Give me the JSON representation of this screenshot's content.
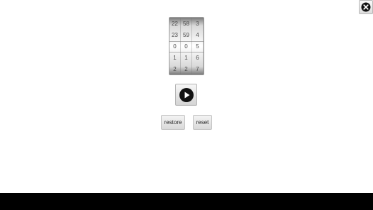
{
  "picker": {
    "columns": [
      [
        "22",
        "23",
        "0",
        "1",
        "2"
      ],
      [
        "58",
        "59",
        "0",
        "1",
        "2"
      ],
      [
        "3",
        "4",
        "5",
        "6",
        "7"
      ]
    ]
  },
  "buttons": {
    "restore_label": "restore",
    "reset_label": "reset"
  },
  "icons": {
    "close": "close-icon",
    "play": "play-icon"
  },
  "colors": {
    "bottom_bar": "#000000",
    "icon": "#000000"
  }
}
